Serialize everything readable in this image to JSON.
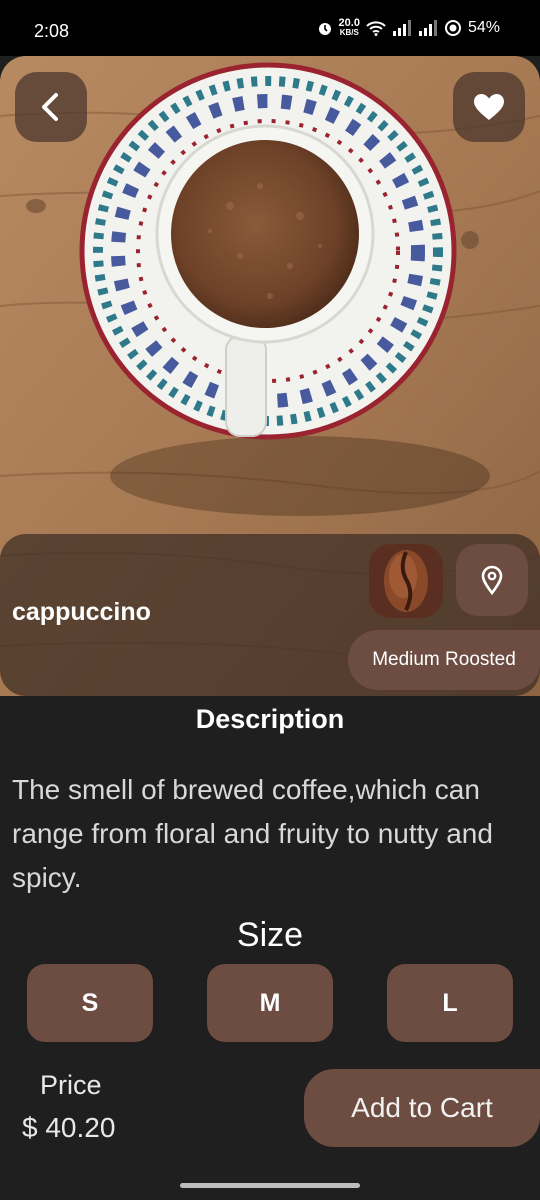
{
  "status_bar": {
    "time": "2:08",
    "net_speed": "20.0",
    "net_unit": "KB/S",
    "battery": "54%"
  },
  "product": {
    "name": "cappuccino",
    "roast": "Medium Roosted"
  },
  "description": {
    "title": "Description",
    "text": "The smell of brewed coffee,which can range from floral and fruity to nutty and spicy."
  },
  "size": {
    "title": "Size",
    "options": [
      "S",
      "M",
      "L"
    ]
  },
  "price": {
    "label": "Price",
    "value": "$ 40.20"
  },
  "cart": {
    "label": "Add to Cart"
  },
  "colors": {
    "accent": "#6d4c41",
    "background": "#1f1f1f"
  },
  "icons": {
    "back": "chevron-left-icon",
    "favorite": "heart-icon",
    "location": "location-pin-icon",
    "bean": "coffee-bean-icon"
  }
}
